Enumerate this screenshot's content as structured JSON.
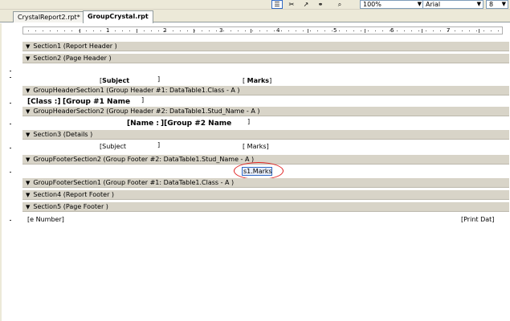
{
  "toolbar": {
    "zoom": "100%",
    "font": "Arial",
    "size": "8"
  },
  "tabs": [
    {
      "label": "CrystalReport2.rpt*"
    },
    {
      "label": "GroupCrystal.rpt"
    }
  ],
  "ruler": {
    "numbers": [
      "1",
      "2",
      "3",
      "4",
      "5",
      "6",
      "7"
    ]
  },
  "sections": {
    "s1": "Section1 (Report Header )",
    "s2": "Section2 (Page Header )",
    "gh1": "GroupHeaderSection1 (Group Header #1: DataTable1.Class - A )",
    "gh2": "GroupHeaderSection2 (Group Header #2: DataTable1.Stud_Name - A )",
    "s3": "Section3 (Details )",
    "gf2": "GroupFooterSection2 (Group Footer #2: DataTable1.Stud_Name - A )",
    "gf1": "GroupFooterSection1 (Group Footer #1: DataTable1.Class - A )",
    "s4": "Section4 (Report Footer )",
    "s5": "Section5 (Page Footer )"
  },
  "fields": {
    "ph_subject": "Subject",
    "ph_marks": "Marks",
    "class_label": "Class :",
    "group1_name": "Group #1 Name",
    "name_label": "Name :",
    "group2_name": "Group #2 Name",
    "det_subject": "Subject",
    "det_marks": "Marks",
    "sum_marks": "s1.Marks",
    "page_number": "e Number",
    "print_date": "Print Dat"
  }
}
